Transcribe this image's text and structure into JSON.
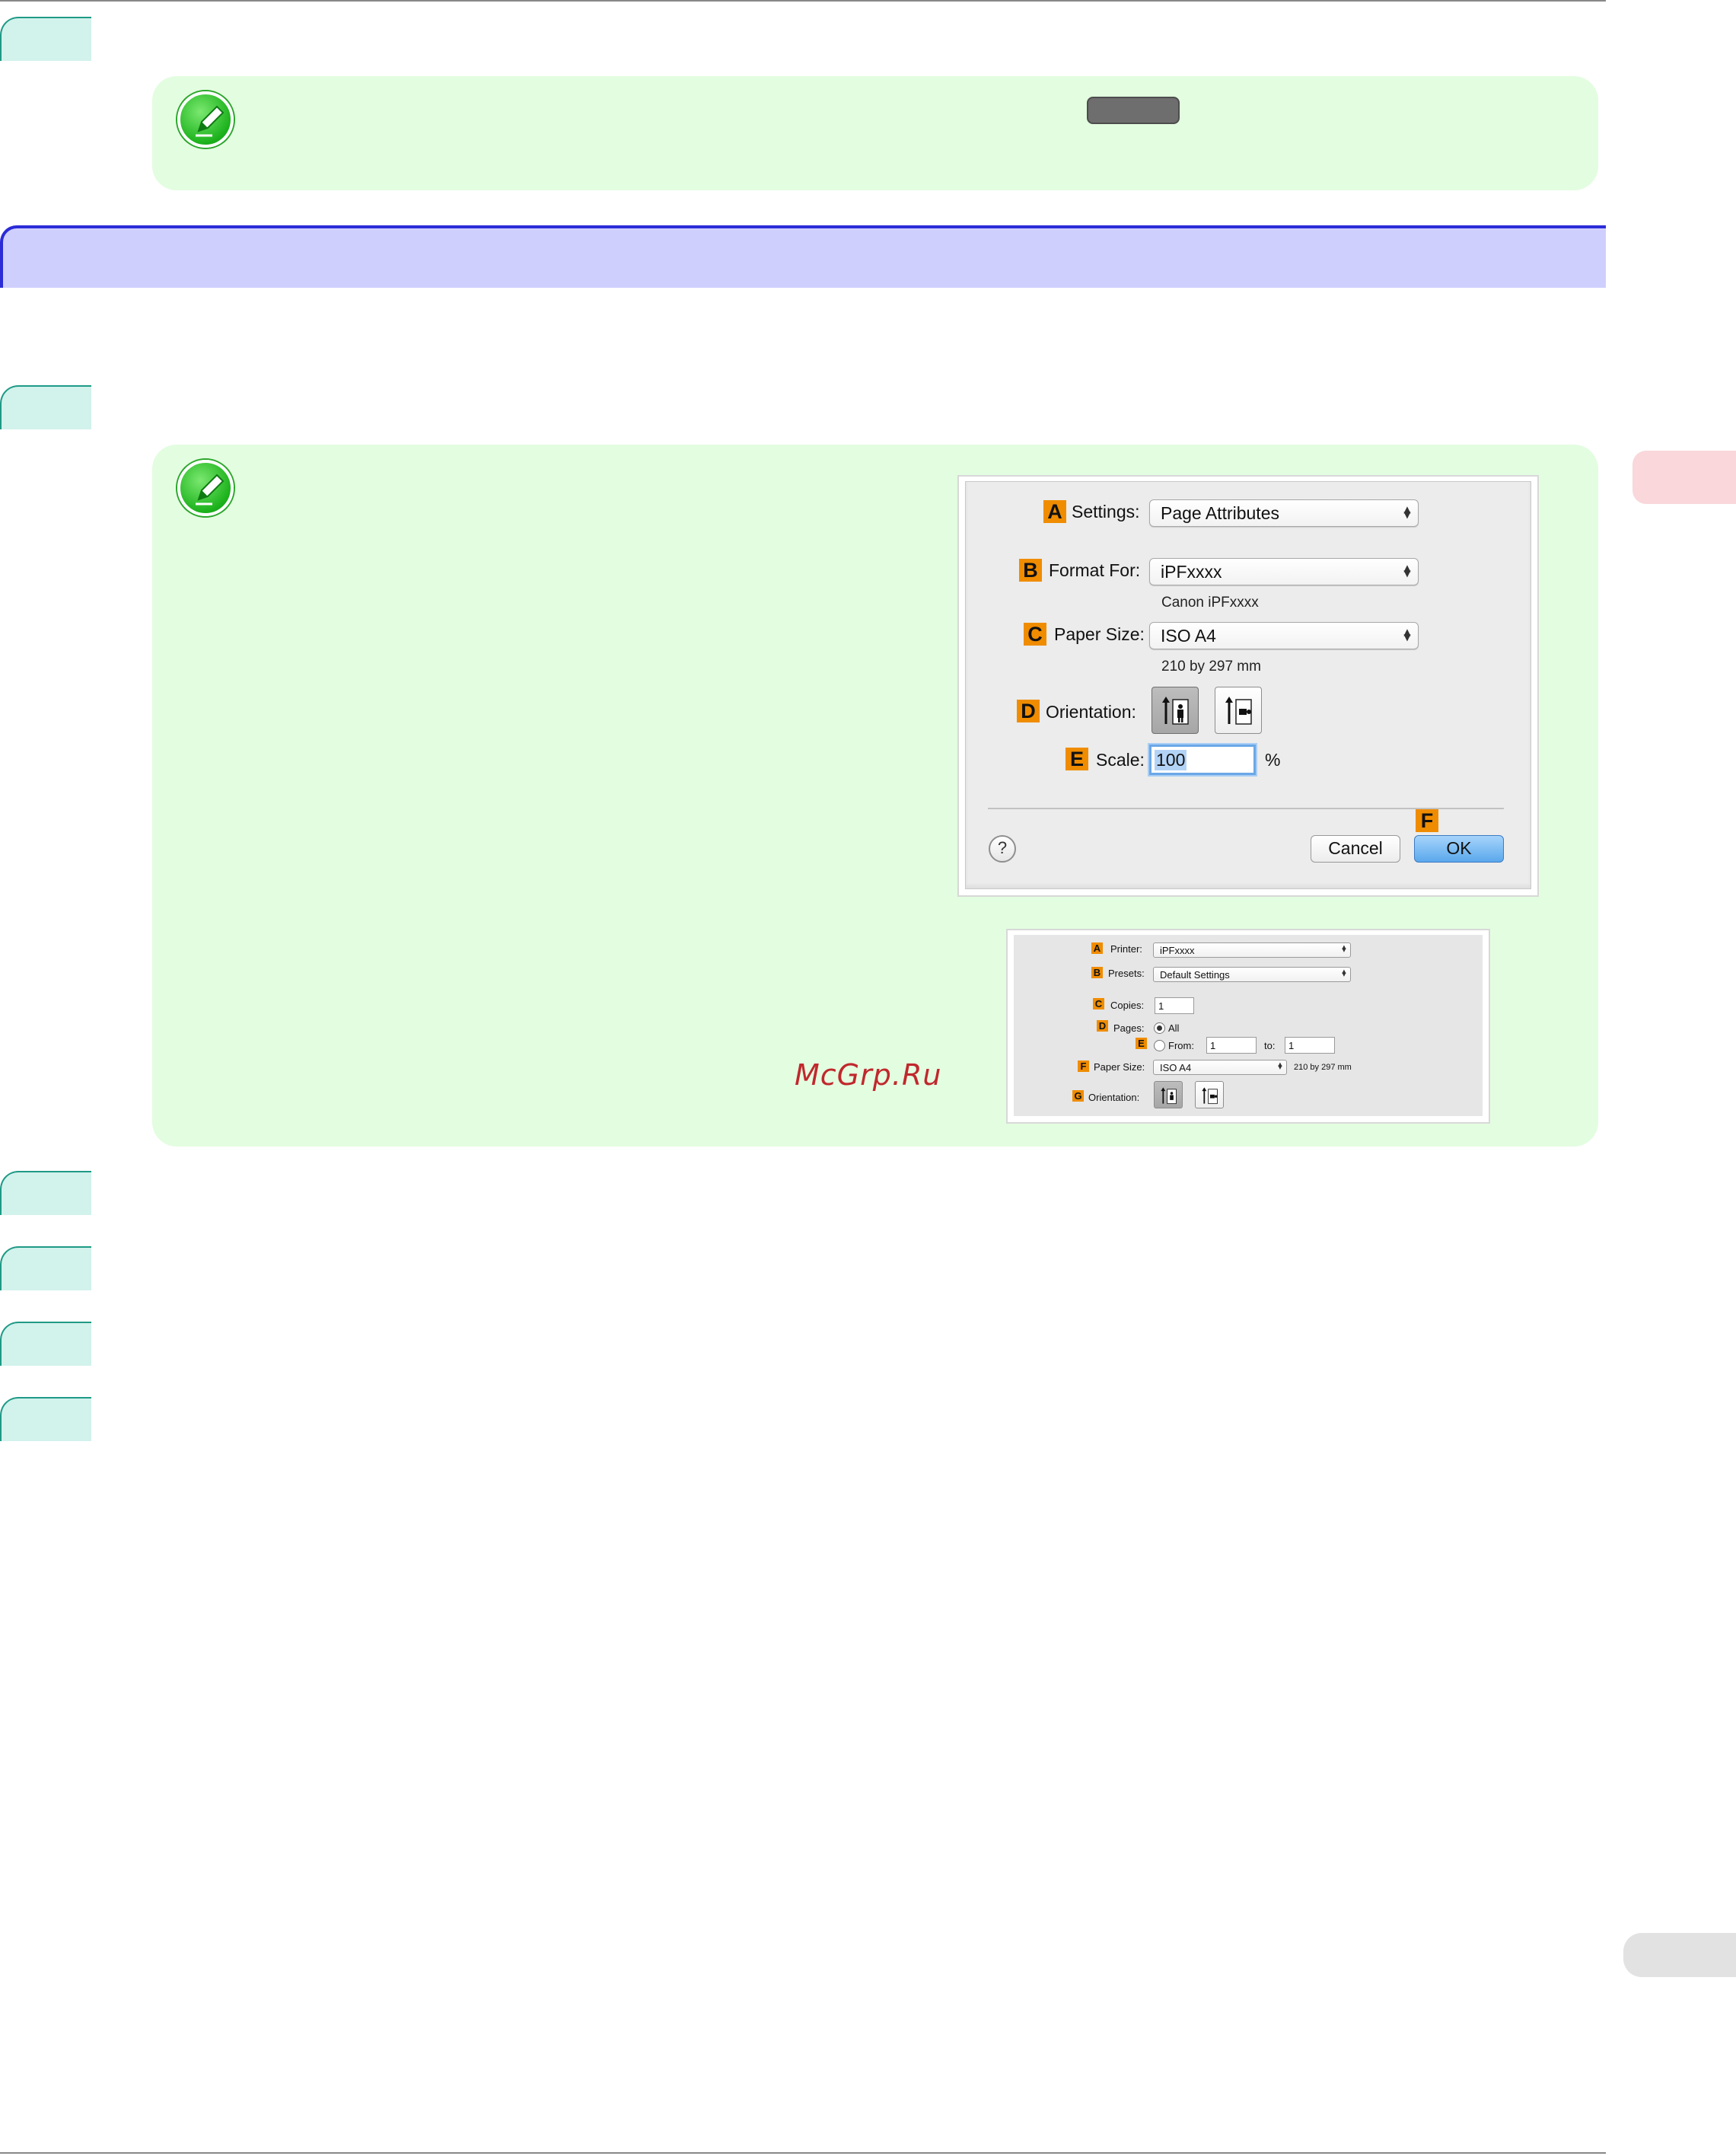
{
  "note_top": {
    "key_badge": ""
  },
  "page_setup_dialog": {
    "settings": {
      "tag": "A",
      "label": "Settings:",
      "value": "Page Attributes"
    },
    "format_for": {
      "tag": "B",
      "label": "Format For:",
      "value": "iPFxxxx",
      "sub": "Canon iPFxxxx"
    },
    "paper_size": {
      "tag": "C",
      "label": "Paper Size:",
      "value": "ISO A4",
      "sub": "210 by 297 mm"
    },
    "orientation": {
      "tag": "D",
      "label": "Orientation:",
      "selected": "portrait"
    },
    "scale": {
      "tag": "E",
      "label": "Scale:",
      "value": "100",
      "unit": "%"
    },
    "help_glyph": "?",
    "cancel_label": "Cancel",
    "ok_tag": "F",
    "ok_label": "OK"
  },
  "print_dialog": {
    "printer": {
      "tag": "A",
      "label": "Printer:",
      "value": "iPFxxxx"
    },
    "presets": {
      "tag": "B",
      "label": "Presets:",
      "value": "Default Settings"
    },
    "copies": {
      "tag": "C",
      "label": "Copies:",
      "value": "1"
    },
    "pages": {
      "tag": "D",
      "label": "Pages:",
      "all_label": "All",
      "selected": "All"
    },
    "range": {
      "tag": "E",
      "from_label": "From:",
      "from_value": "1",
      "to_label": "to:",
      "to_value": "1"
    },
    "paper_size": {
      "tag": "F",
      "label": "Paper Size:",
      "value": "ISO A4",
      "sub": "210 by 297 mm"
    },
    "orientation": {
      "tag": "G",
      "label": "Orientation:",
      "selected": "portrait"
    }
  },
  "watermark": "McGrp.Ru",
  "colors": {
    "note_bg": "#e3fde0",
    "section_band": "#cfcffd",
    "section_border": "#2b2bd8",
    "step_tab": "#d2f2ec",
    "tag_orange": "#f08c00",
    "side_tab_pink": "#f9d7da"
  },
  "icons": [
    "pencil-note-icon",
    "help-icon",
    "portrait-orientation-icon",
    "landscape-orientation-icon",
    "popup-arrows-icon",
    "radio-icon"
  ]
}
